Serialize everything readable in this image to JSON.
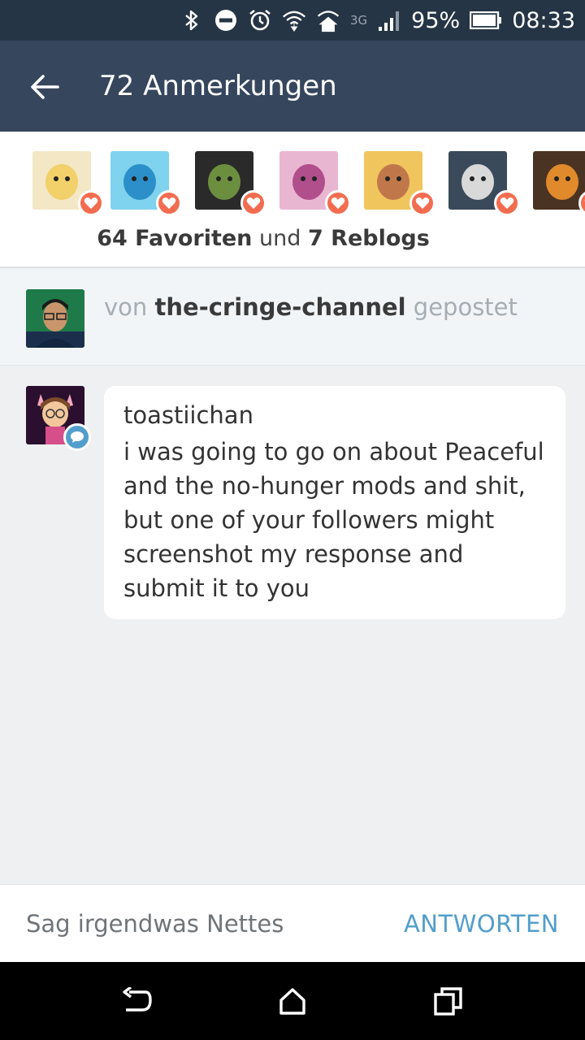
{
  "status_bar": {
    "battery_percent": "95%",
    "time": "08:33",
    "network": "3G",
    "icons": [
      "bluetooth-icon",
      "do-not-disturb-icon",
      "alarm-icon",
      "wifi-icon",
      "home-wifi-icon",
      "signal-icon",
      "battery-icon"
    ]
  },
  "app_bar": {
    "title": "72 Anmerkungen",
    "back_icon": "back-arrow-icon"
  },
  "likes": {
    "avatars": [
      {
        "name": "avatar-1",
        "bg": "#f3e7c6",
        "accent": "#f2d06a"
      },
      {
        "name": "avatar-2",
        "bg": "#7fd3ee",
        "accent": "#2c8fc9"
      },
      {
        "name": "avatar-3",
        "bg": "#2a2a2a",
        "accent": "#6b8f3f"
      },
      {
        "name": "avatar-4",
        "bg": "#e9b6d2",
        "accent": "#b04f8c"
      },
      {
        "name": "avatar-5",
        "bg": "#f1c55e",
        "accent": "#c0784a"
      },
      {
        "name": "avatar-6",
        "bg": "#3b4a5a",
        "accent": "#d9d9d9"
      },
      {
        "name": "avatar-7",
        "bg": "#4a3322",
        "accent": "#e08a2c"
      }
    ],
    "favorites_count": "64 Favoriten",
    "connector": "und",
    "reblogs_count": "7 Reblogs"
  },
  "posted_by": {
    "prefix": "von",
    "username": "the-cringe-channel",
    "suffix": "gepostet"
  },
  "reply": {
    "username": "toastiichan",
    "lines": [
      "i was going to go on about Peaceful",
      "and the no-hunger mods and shit,",
      "but one of your followers might",
      "screenshot my response and",
      "submit it to you"
    ]
  },
  "compose": {
    "placeholder": "Sag irgendwas Nettes",
    "reply_label": "ANTWORTEN"
  },
  "colors": {
    "status_bar": "#263545",
    "app_bar": "#36465d",
    "heart_badge": "#f26d50",
    "reply_accent": "#529ecc"
  },
  "nav": {
    "icons": [
      "back-icon",
      "home-icon",
      "recents-icon"
    ]
  }
}
